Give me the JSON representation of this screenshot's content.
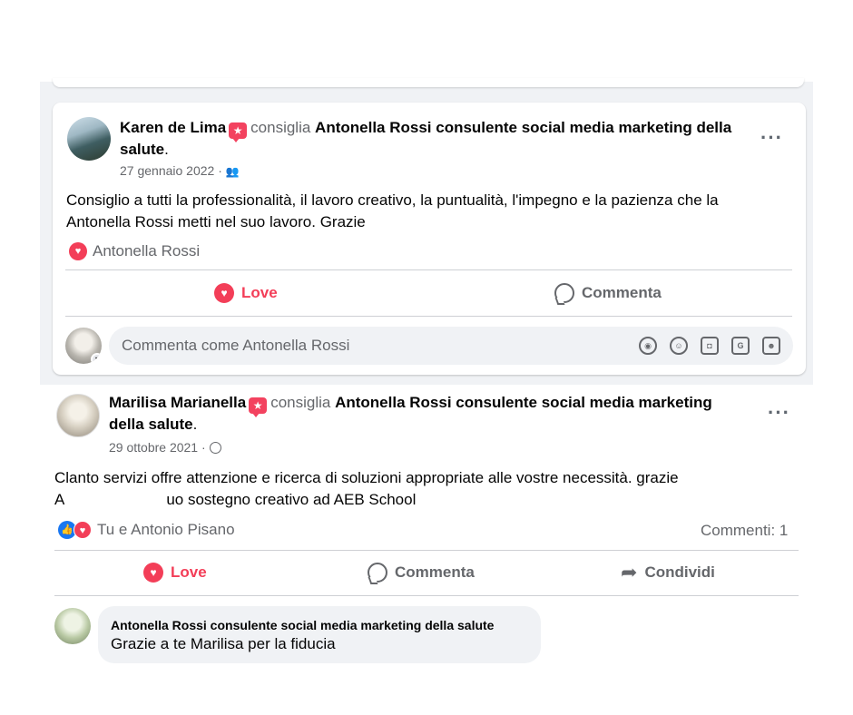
{
  "post1": {
    "author": "Karen de Lima",
    "recommends": "consiglia",
    "page_name": "Antonella Rossi consulente social media marketing della",
    "page_name_cont": "salute",
    "page_suffix": ".",
    "date": "27 gennaio 2022 ·",
    "audience_icon": "friends-icon",
    "text_line1": "Consiglio a tutti la professionalità, il lavoro creativo, la puntualità, l'impegno  e la pazienza che la",
    "text_line2": "Antonella Rossi metti nel suo lavoro. Grazie",
    "reactions": "Antonella Rossi",
    "love_label": "Love",
    "comment_label": "Commenta",
    "comment_placeholder": "Commenta come Antonella Rossi"
  },
  "post2": {
    "author": "Marilisa Marianella",
    "recommends": "consiglia",
    "page_name": "Antonella Rossi consulente social media marketing",
    "page_name_cont": "della salute",
    "page_suffix": ".",
    "date": "29 ottobre 2021 ·",
    "audience_icon": "globe-icon",
    "text_line1": "Clanto servizi offre attenzione e ricerca di soluzioni appropriate alle vostre necessità. grazie",
    "text_line2_start": "A",
    "text_line2_end": "uo sostegno creativo ad AEB School",
    "reactions": "Tu e Antonio Pisano",
    "comments_count": "Commenti: 1",
    "love_label": "Love",
    "comment_label": "Commenta",
    "share_label": "Condividi",
    "reply_author": "Antonella Rossi consulente social media marketing della salute",
    "reply_text": "Grazie a te Marilisa per la fiducia"
  },
  "colors": {
    "love": "#f33e58",
    "like": "#1877f2",
    "muted": "#65676b",
    "bg": "#f0f2f5"
  }
}
